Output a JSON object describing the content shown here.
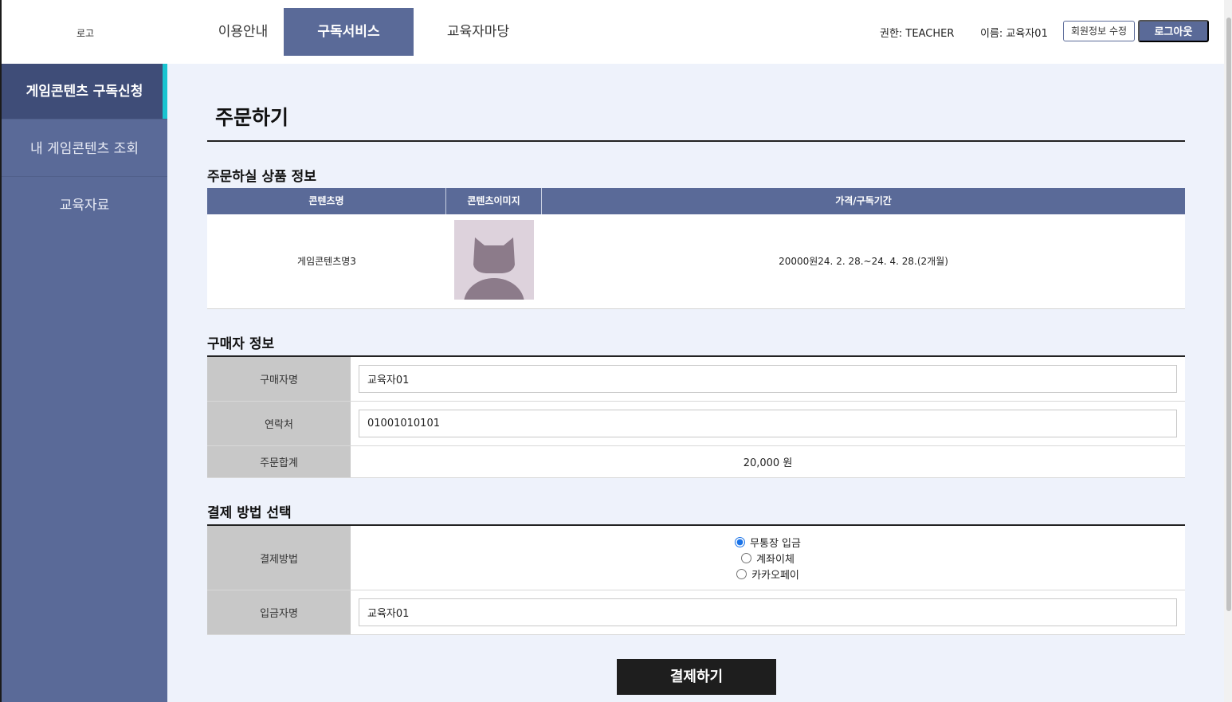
{
  "header": {
    "logo": "로고",
    "nav": [
      "이용안내",
      "구독서비스",
      "교육자마당"
    ],
    "active_nav": 1,
    "role": "권한: TEACHER",
    "user_name": "이름: 교육자01",
    "edit_profile_label": "회원정보 수정",
    "logout_label": "로그아웃"
  },
  "sidebar": {
    "items": [
      {
        "label": "게임콘텐츠 구독신청"
      },
      {
        "label": "내 게임콘텐츠 조회"
      },
      {
        "label": "교육자료"
      }
    ],
    "active": 0
  },
  "page": {
    "title": "주문하기"
  },
  "product_section": {
    "title": "주문하실 상품 정보",
    "columns": [
      "콘텐츠명",
      "콘텐츠이미지",
      "가격/구독기간"
    ],
    "row": {
      "name": "게임콘텐츠명3",
      "price_period": "20000원24. 2. 28.~24. 4. 28.(2개월)"
    }
  },
  "buyer_section": {
    "title": "구매자 정보",
    "name_label": "구매자명",
    "name_value": "교육자01",
    "phone_label": "연락처",
    "phone_value": "01001010101",
    "total_label": "주문합계",
    "total_value": "20,000 원"
  },
  "payment_section": {
    "title": "결제 방법 선택",
    "method_label": "결제방법",
    "options": [
      "무통장 입금",
      "계좌이체",
      "카카오페이"
    ],
    "selected": 0,
    "depositor_label": "입금자명",
    "depositor_value": "교육자01"
  },
  "submit_label": "결제하기",
  "colors": {
    "primary": "#5a6a98",
    "sidebar_active": "#3f4d78",
    "accent": "#19c4d0",
    "content_bg": "#eef2fb",
    "button_dark": "#1e1e1e"
  }
}
